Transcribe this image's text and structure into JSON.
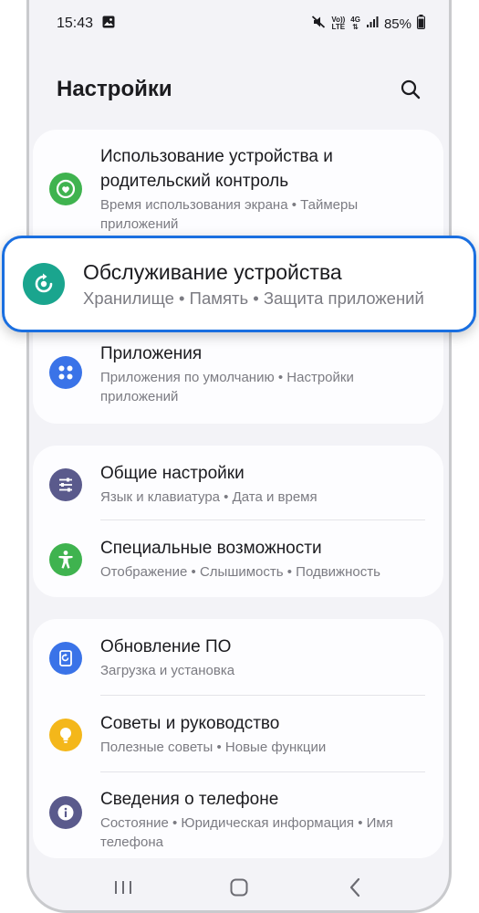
{
  "status": {
    "time": "15:43",
    "volte_top": "Vo))",
    "volte_bottom": "LTE",
    "network": "4G",
    "battery": "85%"
  },
  "header": {
    "title": "Настройки"
  },
  "groups": [
    {
      "items": [
        {
          "title": "Использование устройства и родительский контроль",
          "sub": "Время использования экрана • Таймеры приложений",
          "icon": "heart-shield-icon",
          "color": "#3fb34f"
        },
        {
          "title": "Приложения",
          "sub": "Приложения по умолчанию • Настройки приложений",
          "icon": "apps-grid-icon",
          "color": "#3a73e8"
        }
      ]
    },
    {
      "items": [
        {
          "title": "Общие настройки",
          "sub": "Язык и клавиатура • Дата и время",
          "icon": "sliders-icon",
          "color": "#5a5a8c"
        },
        {
          "title": "Специальные возможности",
          "sub": "Отображение • Слышимость • Подвижность",
          "icon": "accessibility-icon",
          "color": "#3fb34f"
        }
      ]
    },
    {
      "items": [
        {
          "title": "Обновление ПО",
          "sub": "Загрузка и установка",
          "icon": "update-icon",
          "color": "#3a73e8"
        },
        {
          "title": "Советы и руководство",
          "sub": "Полезные советы • Новые функции",
          "icon": "lightbulb-icon",
          "color": "#f4b71a"
        },
        {
          "title": "Сведения о телефоне",
          "sub": "Состояние • Юридическая информация • Имя телефона",
          "icon": "info-icon",
          "color": "#5a5a8c"
        }
      ]
    }
  ],
  "highlight": {
    "title": "Обслуживание устройства",
    "sub": "Хранилище • Память • Защита приложений",
    "icon": "device-care-icon",
    "color": "#1aa58e",
    "border_color": "#1a6fe0"
  },
  "navbar": {
    "recents": "recents-icon",
    "home": "home-icon",
    "back": "back-icon"
  }
}
